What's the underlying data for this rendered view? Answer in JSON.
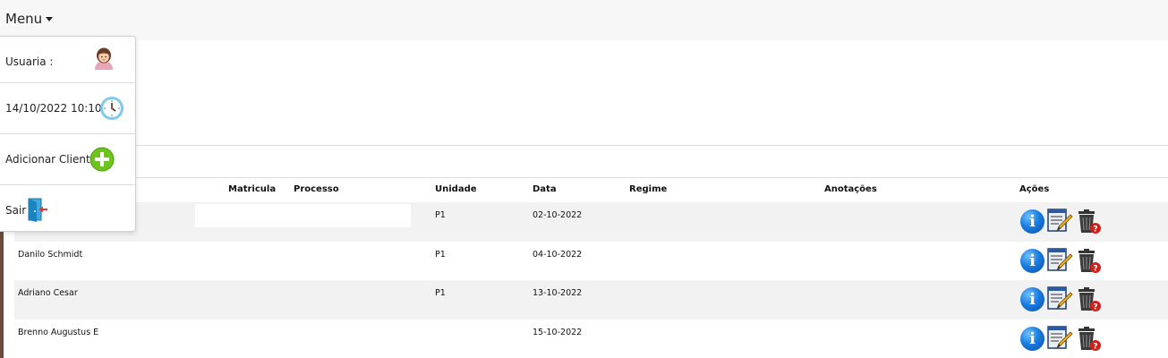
{
  "menu": {
    "label": "Menu"
  },
  "dropdown": {
    "user_label": "Usuaria :",
    "datetime": "14/10/2022 10:10",
    "add_client": "Adicionar Cliente",
    "logout": "Sair"
  },
  "table": {
    "headers": {
      "matricula": "Matricula",
      "processo": "Processo",
      "unidade": "Unidade",
      "data": "Data",
      "regime": "Regime",
      "anotacoes": "Anotações",
      "acoes": "Ações"
    },
    "rows": [
      {
        "name": "",
        "unidade": "P1",
        "data": "02-10-2022"
      },
      {
        "name": "Danilo Schmidt",
        "unidade": "P1",
        "data": "04-10-2022"
      },
      {
        "name": "Adriano Cesar",
        "unidade": "P1",
        "data": "13-10-2022"
      },
      {
        "name": "Brenno Augustus E",
        "unidade": "",
        "data": "15-10-2022"
      }
    ]
  },
  "icons": {
    "info": "info-icon",
    "edit": "edit-icon",
    "delete": "trash-icon",
    "user": "user-avatar-icon",
    "clock": "clock-icon",
    "add": "plus-circle-icon",
    "exit": "exit-door-icon"
  },
  "colors": {
    "accent_left_bar": "#6b4a3a",
    "info_blue": "#1a7be0",
    "add_green": "#6cc51d",
    "row_alt": "#f2f2f2"
  }
}
